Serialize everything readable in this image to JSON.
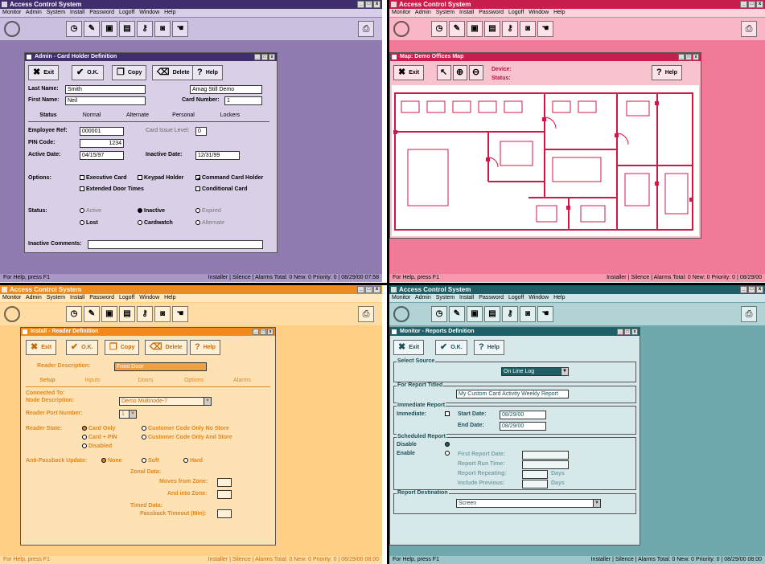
{
  "app": {
    "title": "Access Control System",
    "menu": [
      "Monitor",
      "Admin",
      "System",
      "Install",
      "Password",
      "Logoff",
      "Window",
      "Help"
    ],
    "status_left": "For Help, press F1",
    "status_installer": "Installer",
    "status_silence": "Silence",
    "status_alarms": "Alarms Total: 0 New: 0 Priority: 0",
    "status_date": "08/29/00",
    "status_time_tl": "07:58",
    "status_time_bl": "08:00"
  },
  "colors": {
    "purple": "#8f7bb0",
    "purple_title": "#3f2d6d",
    "pink": "#f07a97",
    "pink_title": "#c81e4d",
    "orange": "#ffcf85",
    "orange_title": "#f08a1d",
    "teal": "#6fa8ad",
    "teal_title": "#1e5e66"
  },
  "icons": [
    "globe-icon",
    "clock-icon",
    "card-icon",
    "monitor-icon",
    "document-icon",
    "key-icon",
    "camera-icon",
    "hand-icon",
    "printer-icon"
  ],
  "card": {
    "title": "Admin - Card Holder Definition",
    "exit": "Exit",
    "ok": "O.K.",
    "copy": "Copy",
    "delete": "Delete",
    "help": "Help",
    "last_name_label": "Last Name:",
    "last_name": "Smith",
    "first_name_label": "First Name:",
    "first_name": "Neil",
    "company": "Amag Still Demo",
    "card_number_label": "Card Number:",
    "card_number": "1",
    "tabs": [
      "Status",
      "Normal",
      "Alternate",
      "Personal",
      "Lockers"
    ],
    "emp_ref_label": "Employee Ref:",
    "emp_ref": "000001",
    "card_issue_label": "Card Issue Level:",
    "card_issue": "0",
    "pin_label": "PIN Code:",
    "pin": "1234",
    "active_label": "Active Date:",
    "active": "04/15/97",
    "inactive_label": "Inactive Date:",
    "inactive": "12/31/99",
    "options_label": "Options:",
    "opt1": "Executive Card",
    "opt2": "Keypad Holder",
    "opt3": "Command Card Holder",
    "opt4": "Extended Door Times",
    "opt5": "Conditional Card",
    "status_label": "Status:",
    "st1": "Active",
    "st2": "Inactive",
    "st3": "Expired",
    "st4": "Lost",
    "st5": "Cardwatch",
    "st6": "Alternate",
    "comments_label": "Inactive Comments:"
  },
  "map": {
    "title": "Map: Demo Offices Map",
    "exit": "Exit",
    "help": "Help",
    "device_label": "Device:",
    "status_label": "Status:"
  },
  "reader": {
    "title": "Install - Reader Definition",
    "exit": "Exit",
    "ok": "O.K.",
    "copy": "Copy",
    "delete": "Delete",
    "help": "Help",
    "desc_label": "Reader Description:",
    "desc": "Front Door",
    "tabs": [
      "Setup",
      "Inputs",
      "Doors",
      "Options",
      "Alarms"
    ],
    "connected_label": "Connected To:",
    "node_label": "Node Description:",
    "node": "Demo Multinode-7",
    "port_label": "Reader Port Number:",
    "port": "1",
    "mode_label": "Reader State:",
    "m1": "Card Only",
    "m2": "Card + PIN",
    "m3": "Disabled",
    "m4": "Customer Code Only  No Store",
    "m5": "Customer Code Only  And Store",
    "apb_label": "Anti-Passback Update:",
    "apb1": "None",
    "apb2": "Soft",
    "apb3": "Hard",
    "zonal_label": "Zonal Data:",
    "from_label": "Moves from Zone:",
    "to_label": "And into Zone:",
    "timed_label": "Timed Data:",
    "timeout_label": "Passback Timeout (Min):"
  },
  "report": {
    "title": "Monitor - Reports Definition",
    "exit": "Exit",
    "ok": "O.K.",
    "help": "Help",
    "source_group": "Select Source",
    "source": "On Line Log",
    "title_group": "For Report Titled",
    "report_title": "My Custom Card Activity Weekly Report",
    "imm_group": "Immediate Report",
    "imm_label": "Immediate:",
    "start_label": "Start Date:",
    "start": "08/29/00",
    "end_label": "End Date:",
    "end": "08/29/00",
    "sched_group": "Scheduled Report",
    "disable": "Disable",
    "enable": "Enable",
    "first_label": "First Report Date:",
    "run_label": "Report Run Time:",
    "repeat_label": "Report Repeating:",
    "prev_label": "Include Previous:",
    "days1": "Days",
    "days2": "Days",
    "dest_group": "Report Destination",
    "dest": "Screen"
  }
}
